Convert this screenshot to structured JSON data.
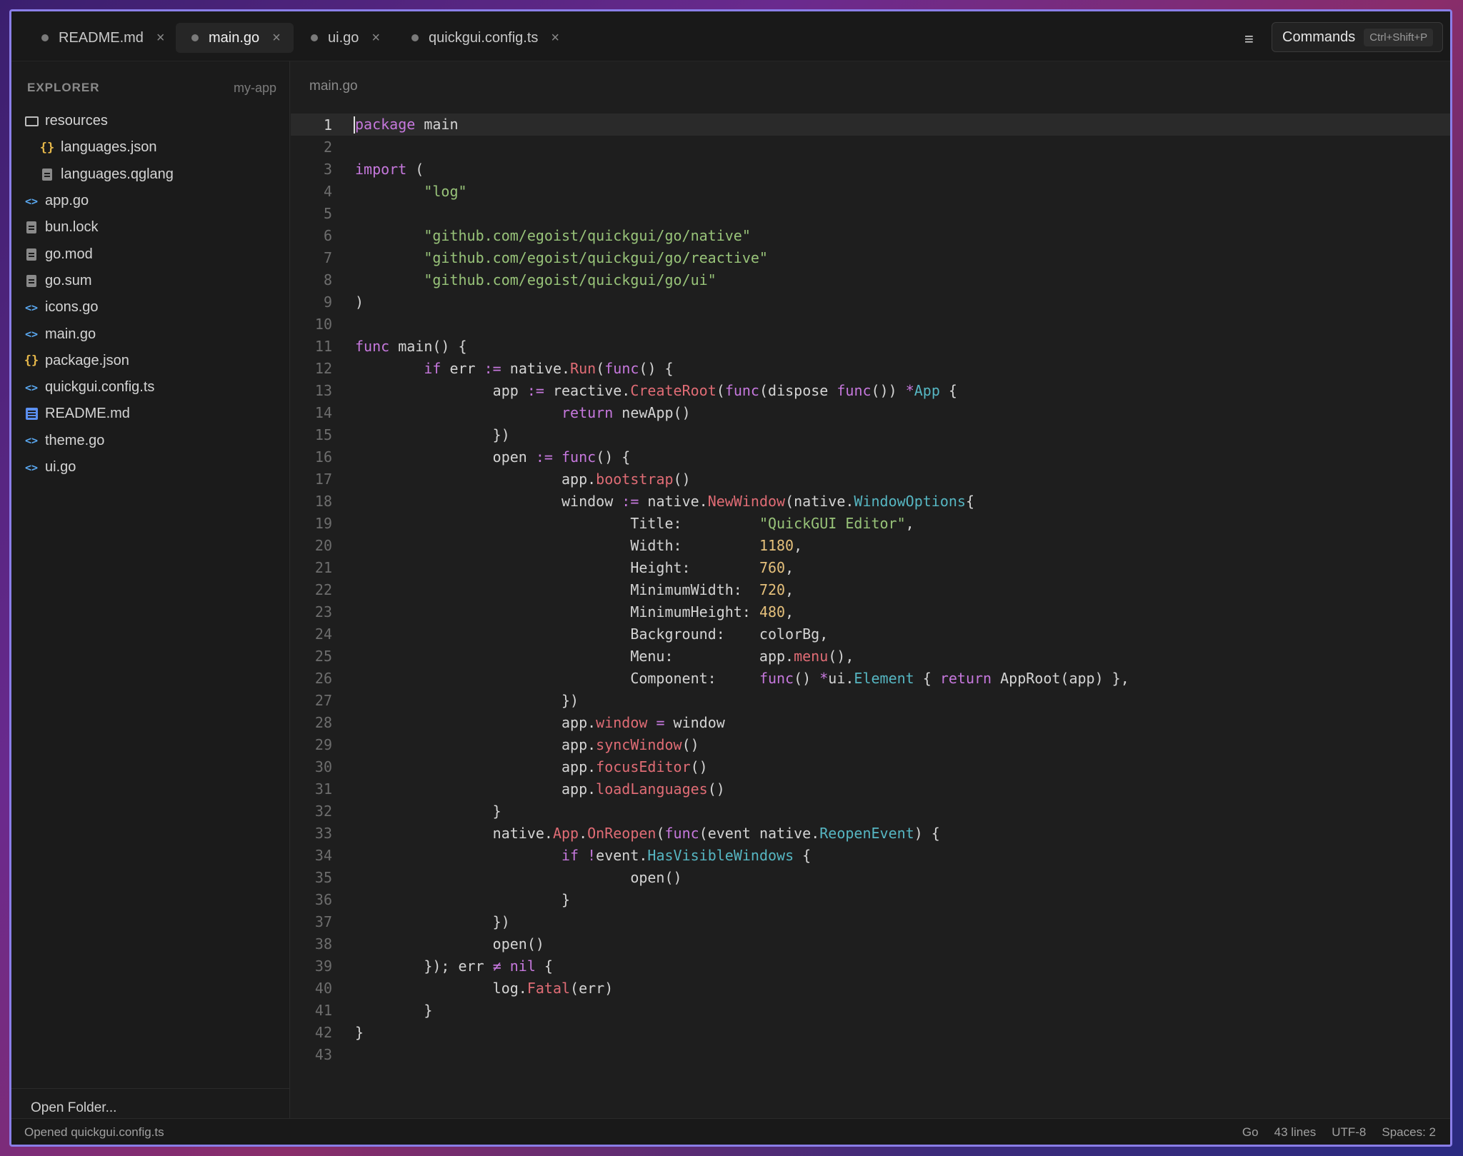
{
  "tabs": [
    {
      "label": "README.md",
      "active": false
    },
    {
      "label": "main.go",
      "active": true
    },
    {
      "label": "ui.go",
      "active": false
    },
    {
      "label": "quickgui.config.ts",
      "active": false
    }
  ],
  "tab_close_glyph": "×",
  "menu_glyph": "≡",
  "commands": {
    "label": "Commands",
    "shortcut": "Ctrl+Shift+P"
  },
  "sidebar": {
    "header": "EXPLORER",
    "project": "my-app",
    "files": [
      {
        "label": "resources",
        "icon": "folder-icon"
      },
      {
        "label": "languages.json",
        "icon": "json-icon"
      },
      {
        "label": "languages.qglang",
        "icon": "file-icon"
      },
      {
        "label": "app.go",
        "icon": "code-icon"
      },
      {
        "label": "bun.lock",
        "icon": "file-icon"
      },
      {
        "label": "go.mod",
        "icon": "file-icon"
      },
      {
        "label": "go.sum",
        "icon": "file-icon"
      },
      {
        "label": "icons.go",
        "icon": "code-icon"
      },
      {
        "label": "main.go",
        "icon": "code-icon"
      },
      {
        "label": "package.json",
        "icon": "json-icon"
      },
      {
        "label": "quickgui.config.ts",
        "icon": "code-icon"
      },
      {
        "label": "README.md",
        "icon": "markdown-icon"
      },
      {
        "label": "theme.go",
        "icon": "code-icon"
      },
      {
        "label": "ui.go",
        "icon": "code-icon"
      }
    ],
    "footer": "Open Folder..."
  },
  "editor": {
    "breadcrumb": "main.go",
    "current_line": 1,
    "lines": [
      "package main",
      "",
      "import (",
      "        \"log\"",
      "",
      "        \"github.com/egoist/quickgui/go/native\"",
      "        \"github.com/egoist/quickgui/go/reactive\"",
      "        \"github.com/egoist/quickgui/go/ui\"",
      ")",
      "",
      "func main() {",
      "        if err := native.Run(func() {",
      "                app := reactive.CreateRoot(func(dispose func()) *App {",
      "                        return newApp()",
      "                })",
      "                open := func() {",
      "                        app.bootstrap()",
      "                        window := native.NewWindow(native.WindowOptions{",
      "                                Title:         \"QuickGUI Editor\",",
      "                                Width:         1180,",
      "                                Height:        760,",
      "                                MinimumWidth:  720,",
      "                                MinimumHeight: 480,",
      "                                Background:    colorBg,",
      "                                Menu:          app.menu(),",
      "                                Component:     func() *ui.Element { return AppRoot(app) },",
      "                        })",
      "                        app.window = window",
      "                        app.syncWindow()",
      "                        app.focusEditor()",
      "                        app.loadLanguages()",
      "                }",
      "                native.App.OnReopen(func(event native.ReopenEvent) {",
      "                        if !event.HasVisibleWindows {",
      "                                open()",
      "                        }",
      "                })",
      "                open()",
      "        }); err ≠ nil {",
      "                log.Fatal(err)",
      "        }",
      "}",
      ""
    ]
  },
  "status": {
    "message": "Opened quickgui.config.ts",
    "language": "Go",
    "line_count": "43 lines",
    "encoding": "UTF-8",
    "indent": "Spaces: 2"
  },
  "colors": {
    "accent_border": "#8a7ee8",
    "keyword": "#c678dd",
    "string": "#98c379",
    "function": "#e06c75",
    "type": "#56b6c2",
    "number": "#e5c07b"
  }
}
